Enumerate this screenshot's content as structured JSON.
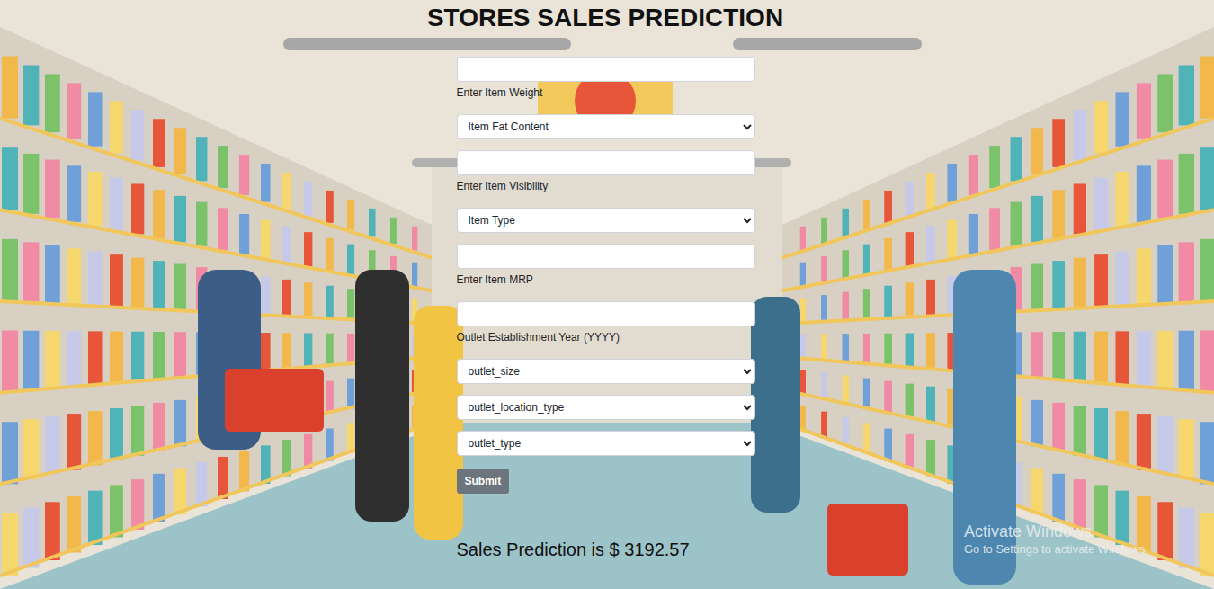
{
  "page": {
    "title": "STORES SALES PREDICTION"
  },
  "fields": [
    {
      "kind": "input",
      "label": "Enter Item Weight"
    },
    {
      "kind": "select",
      "label": "Item Fat Content"
    },
    {
      "kind": "input",
      "label": "Enter Item Visibility"
    },
    {
      "kind": "select",
      "label": "Item Type"
    },
    {
      "kind": "input",
      "label": "Enter Item MRP"
    },
    {
      "kind": "input",
      "label": "Outlet Establishment Year (YYYY)"
    },
    {
      "kind": "select",
      "label": "outlet_size"
    },
    {
      "kind": "select",
      "label": "outlet_location_type"
    },
    {
      "kind": "select",
      "label": "outlet_type"
    }
  ],
  "submit": "Submit",
  "result": "Sales Prediction is $ 3192.57",
  "watermark": {
    "title": "Activate Windows",
    "subtitle": "Go to Settings to activate Windows."
  }
}
